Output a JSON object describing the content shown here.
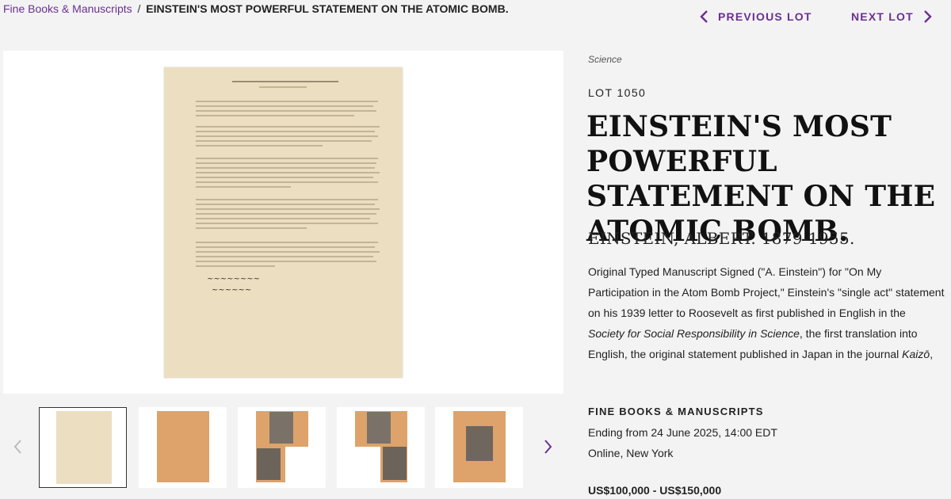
{
  "breadcrumb": {
    "parent": "Fine Books & Manuscripts",
    "separator": "/",
    "current": "EINSTEIN'S MOST POWERFUL STATEMENT ON THE ATOMIC BOMB."
  },
  "lot_nav": {
    "previous_label": "PREVIOUS LOT",
    "next_label": "NEXT LOT",
    "previous_icon": "chevron-left-icon",
    "next_icon": "chevron-right-icon"
  },
  "lot": {
    "category": "Science",
    "number": "LOT 1050",
    "title": "EINSTEIN'S MOST POWERFUL STATEMENT ON THE ATOMIC BOMB.",
    "maker": "EINSTEIN, ALBERT. 1879-1955.",
    "description": {
      "part1": "Original Typed Manuscript Signed (\"A. Einstein\") for \"On My Participation in the Atom Bomb Project,\" Einstein's \"single act\" statement on his 1939 letter to Roosevelt as first published in English in the ",
      "italic1": "Society for Social Responsibility in Science",
      "part2": ", the first translation into English, the original statement published in Japan in the journal ",
      "italic2": "Kaizō",
      "part3": ","
    }
  },
  "sale": {
    "name": "FINE BOOKS & MANUSCRIPTS",
    "date": "Ending from 24 June 2025, 14:00 EDT",
    "location": "Online, New York",
    "estimate": "US$100,000 - US$150,000"
  },
  "colors": {
    "accent": "#6b2f8f",
    "page_bg": "#f3f3f4",
    "paper": "#ecdfc1",
    "thumb_kraft": "#dda36b"
  }
}
